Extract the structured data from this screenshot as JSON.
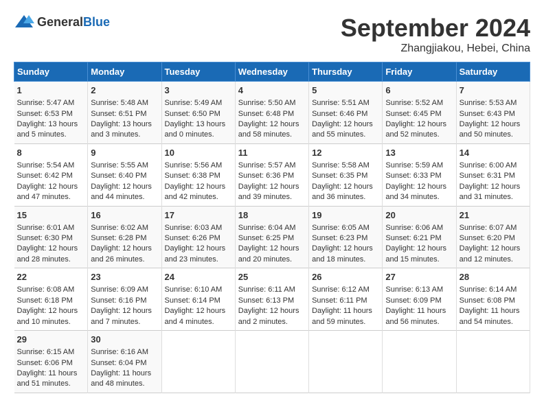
{
  "header": {
    "logo_general": "General",
    "logo_blue": "Blue",
    "title": "September 2024",
    "subtitle": "Zhangjiakou, Hebei, China"
  },
  "days_of_week": [
    "Sunday",
    "Monday",
    "Tuesday",
    "Wednesday",
    "Thursday",
    "Friday",
    "Saturday"
  ],
  "weeks": [
    [
      {
        "day": "1",
        "sunrise": "Sunrise: 5:47 AM",
        "sunset": "Sunset: 6:53 PM",
        "daylight": "Daylight: 13 hours and 5 minutes."
      },
      {
        "day": "2",
        "sunrise": "Sunrise: 5:48 AM",
        "sunset": "Sunset: 6:51 PM",
        "daylight": "Daylight: 13 hours and 3 minutes."
      },
      {
        "day": "3",
        "sunrise": "Sunrise: 5:49 AM",
        "sunset": "Sunset: 6:50 PM",
        "daylight": "Daylight: 13 hours and 0 minutes."
      },
      {
        "day": "4",
        "sunrise": "Sunrise: 5:50 AM",
        "sunset": "Sunset: 6:48 PM",
        "daylight": "Daylight: 12 hours and 58 minutes."
      },
      {
        "day": "5",
        "sunrise": "Sunrise: 5:51 AM",
        "sunset": "Sunset: 6:46 PM",
        "daylight": "Daylight: 12 hours and 55 minutes."
      },
      {
        "day": "6",
        "sunrise": "Sunrise: 5:52 AM",
        "sunset": "Sunset: 6:45 PM",
        "daylight": "Daylight: 12 hours and 52 minutes."
      },
      {
        "day": "7",
        "sunrise": "Sunrise: 5:53 AM",
        "sunset": "Sunset: 6:43 PM",
        "daylight": "Daylight: 12 hours and 50 minutes."
      }
    ],
    [
      {
        "day": "8",
        "sunrise": "Sunrise: 5:54 AM",
        "sunset": "Sunset: 6:42 PM",
        "daylight": "Daylight: 12 hours and 47 minutes."
      },
      {
        "day": "9",
        "sunrise": "Sunrise: 5:55 AM",
        "sunset": "Sunset: 6:40 PM",
        "daylight": "Daylight: 12 hours and 44 minutes."
      },
      {
        "day": "10",
        "sunrise": "Sunrise: 5:56 AM",
        "sunset": "Sunset: 6:38 PM",
        "daylight": "Daylight: 12 hours and 42 minutes."
      },
      {
        "day": "11",
        "sunrise": "Sunrise: 5:57 AM",
        "sunset": "Sunset: 6:36 PM",
        "daylight": "Daylight: 12 hours and 39 minutes."
      },
      {
        "day": "12",
        "sunrise": "Sunrise: 5:58 AM",
        "sunset": "Sunset: 6:35 PM",
        "daylight": "Daylight: 12 hours and 36 minutes."
      },
      {
        "day": "13",
        "sunrise": "Sunrise: 5:59 AM",
        "sunset": "Sunset: 6:33 PM",
        "daylight": "Daylight: 12 hours and 34 minutes."
      },
      {
        "day": "14",
        "sunrise": "Sunrise: 6:00 AM",
        "sunset": "Sunset: 6:31 PM",
        "daylight": "Daylight: 12 hours and 31 minutes."
      }
    ],
    [
      {
        "day": "15",
        "sunrise": "Sunrise: 6:01 AM",
        "sunset": "Sunset: 6:30 PM",
        "daylight": "Daylight: 12 hours and 28 minutes."
      },
      {
        "day": "16",
        "sunrise": "Sunrise: 6:02 AM",
        "sunset": "Sunset: 6:28 PM",
        "daylight": "Daylight: 12 hours and 26 minutes."
      },
      {
        "day": "17",
        "sunrise": "Sunrise: 6:03 AM",
        "sunset": "Sunset: 6:26 PM",
        "daylight": "Daylight: 12 hours and 23 minutes."
      },
      {
        "day": "18",
        "sunrise": "Sunrise: 6:04 AM",
        "sunset": "Sunset: 6:25 PM",
        "daylight": "Daylight: 12 hours and 20 minutes."
      },
      {
        "day": "19",
        "sunrise": "Sunrise: 6:05 AM",
        "sunset": "Sunset: 6:23 PM",
        "daylight": "Daylight: 12 hours and 18 minutes."
      },
      {
        "day": "20",
        "sunrise": "Sunrise: 6:06 AM",
        "sunset": "Sunset: 6:21 PM",
        "daylight": "Daylight: 12 hours and 15 minutes."
      },
      {
        "day": "21",
        "sunrise": "Sunrise: 6:07 AM",
        "sunset": "Sunset: 6:20 PM",
        "daylight": "Daylight: 12 hours and 12 minutes."
      }
    ],
    [
      {
        "day": "22",
        "sunrise": "Sunrise: 6:08 AM",
        "sunset": "Sunset: 6:18 PM",
        "daylight": "Daylight: 12 hours and 10 minutes."
      },
      {
        "day": "23",
        "sunrise": "Sunrise: 6:09 AM",
        "sunset": "Sunset: 6:16 PM",
        "daylight": "Daylight: 12 hours and 7 minutes."
      },
      {
        "day": "24",
        "sunrise": "Sunrise: 6:10 AM",
        "sunset": "Sunset: 6:14 PM",
        "daylight": "Daylight: 12 hours and 4 minutes."
      },
      {
        "day": "25",
        "sunrise": "Sunrise: 6:11 AM",
        "sunset": "Sunset: 6:13 PM",
        "daylight": "Daylight: 12 hours and 2 minutes."
      },
      {
        "day": "26",
        "sunrise": "Sunrise: 6:12 AM",
        "sunset": "Sunset: 6:11 PM",
        "daylight": "Daylight: 11 hours and 59 minutes."
      },
      {
        "day": "27",
        "sunrise": "Sunrise: 6:13 AM",
        "sunset": "Sunset: 6:09 PM",
        "daylight": "Daylight: 11 hours and 56 minutes."
      },
      {
        "day": "28",
        "sunrise": "Sunrise: 6:14 AM",
        "sunset": "Sunset: 6:08 PM",
        "daylight": "Daylight: 11 hours and 54 minutes."
      }
    ],
    [
      {
        "day": "29",
        "sunrise": "Sunrise: 6:15 AM",
        "sunset": "Sunset: 6:06 PM",
        "daylight": "Daylight: 11 hours and 51 minutes."
      },
      {
        "day": "30",
        "sunrise": "Sunrise: 6:16 AM",
        "sunset": "Sunset: 6:04 PM",
        "daylight": "Daylight: 11 hours and 48 minutes."
      },
      null,
      null,
      null,
      null,
      null
    ]
  ]
}
